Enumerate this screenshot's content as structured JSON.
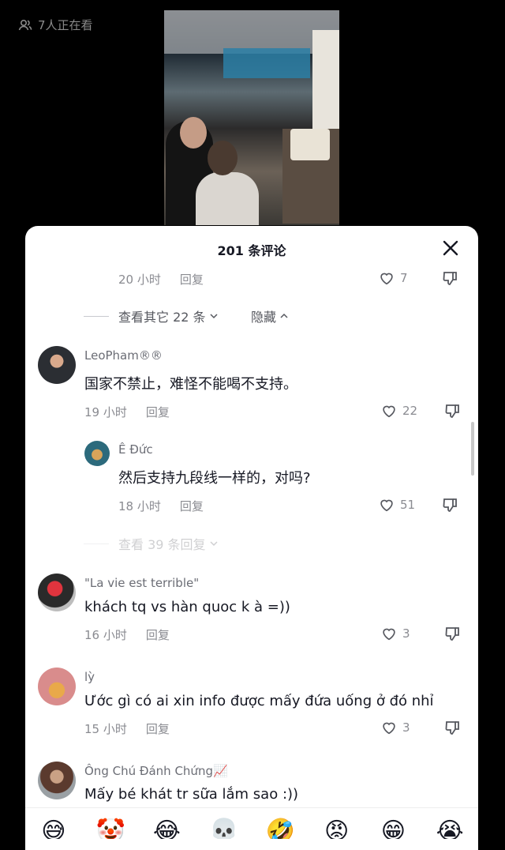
{
  "live": {
    "viewers": "7人正在看"
  },
  "sheet": {
    "title": "201 条评论"
  },
  "top_meta": {
    "time": "20 小时",
    "reply": "回复",
    "likes": "7"
  },
  "expand_replies_1": {
    "label": "查看其它 22 条",
    "hide": "隐藏"
  },
  "comments": [
    {
      "username": "LeoPham®®",
      "text": "国家不禁止，难怪不能喝不支持。",
      "time": "19 小时",
      "reply": "回复",
      "likes": "22"
    },
    {
      "username": "Ê Đức",
      "text": "然后支持九段线一样的，对吗?",
      "time": "18 小时",
      "reply": "回复",
      "likes": "51"
    },
    {
      "username": "\"La vie est terrible\"",
      "text": "khách tq vs hàn quoc k à =))",
      "time": "16 小时",
      "reply": "回复",
      "likes": "3"
    },
    {
      "username": "lỳ",
      "text": "Ước gì có ai xin info được mấy đứa uống ở đó nhỉ",
      "time": "15 小时",
      "reply": "回复",
      "likes": "3"
    },
    {
      "username": "Ông Chú Đánh Chứng📈",
      "text": "Mấy bé khát tr sữa lắm sao :))"
    }
  ],
  "expand_replies_2": {
    "label": "查看 39 条回复"
  },
  "emojis": [
    "😅",
    "🤡",
    "😂",
    "💀",
    "🤣",
    "😡",
    "😁",
    "😭"
  ]
}
